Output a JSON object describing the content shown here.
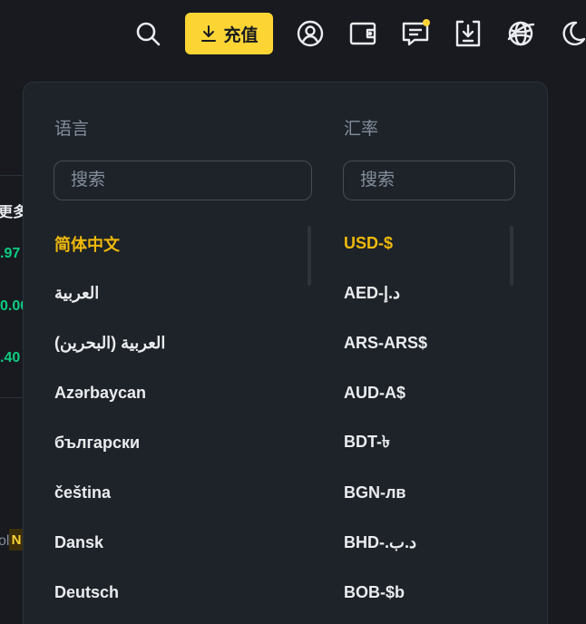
{
  "topbar": {
    "deposit_label": "充值",
    "icons": [
      "search-icon",
      "download-icon",
      "user-icon",
      "wallet-icon",
      "message-icon",
      "app-download-icon",
      "globe-icon",
      "moon-icon"
    ],
    "accent_color": "#fcd535"
  },
  "background": {
    "more_label": "更多",
    "values": [
      ".97",
      "0.00",
      ".40"
    ],
    "value_color": "#0ecb81",
    "fragment_text": "ol",
    "badge_text": "N"
  },
  "language": {
    "title": "语言",
    "search_placeholder": "搜索",
    "items": [
      {
        "label": "简体中文",
        "active": true
      },
      {
        "label": "العربية",
        "active": false
      },
      {
        "label": "العربية (البحرين)",
        "active": false
      },
      {
        "label": "Azərbaycan",
        "active": false
      },
      {
        "label": "български",
        "active": false
      },
      {
        "label": "čeština",
        "active": false
      },
      {
        "label": "Dansk",
        "active": false
      },
      {
        "label": "Deutsch",
        "active": false
      }
    ]
  },
  "currency": {
    "title": "汇率",
    "search_placeholder": "搜索",
    "items": [
      {
        "label": "USD-$",
        "active": true
      },
      {
        "label": "AED-د.إ",
        "active": false
      },
      {
        "label": "ARS-ARS$",
        "active": false
      },
      {
        "label": "AUD-A$",
        "active": false
      },
      {
        "label": "BDT-৳",
        "active": false
      },
      {
        "label": "BGN-лв",
        "active": false
      },
      {
        "label": "BHD-.د.ب",
        "active": false
      },
      {
        "label": "BOB-$b",
        "active": false
      }
    ]
  },
  "colors": {
    "active_item": "#f0b90b",
    "panel_bg": "#1e2329",
    "page_bg": "#181a20"
  }
}
